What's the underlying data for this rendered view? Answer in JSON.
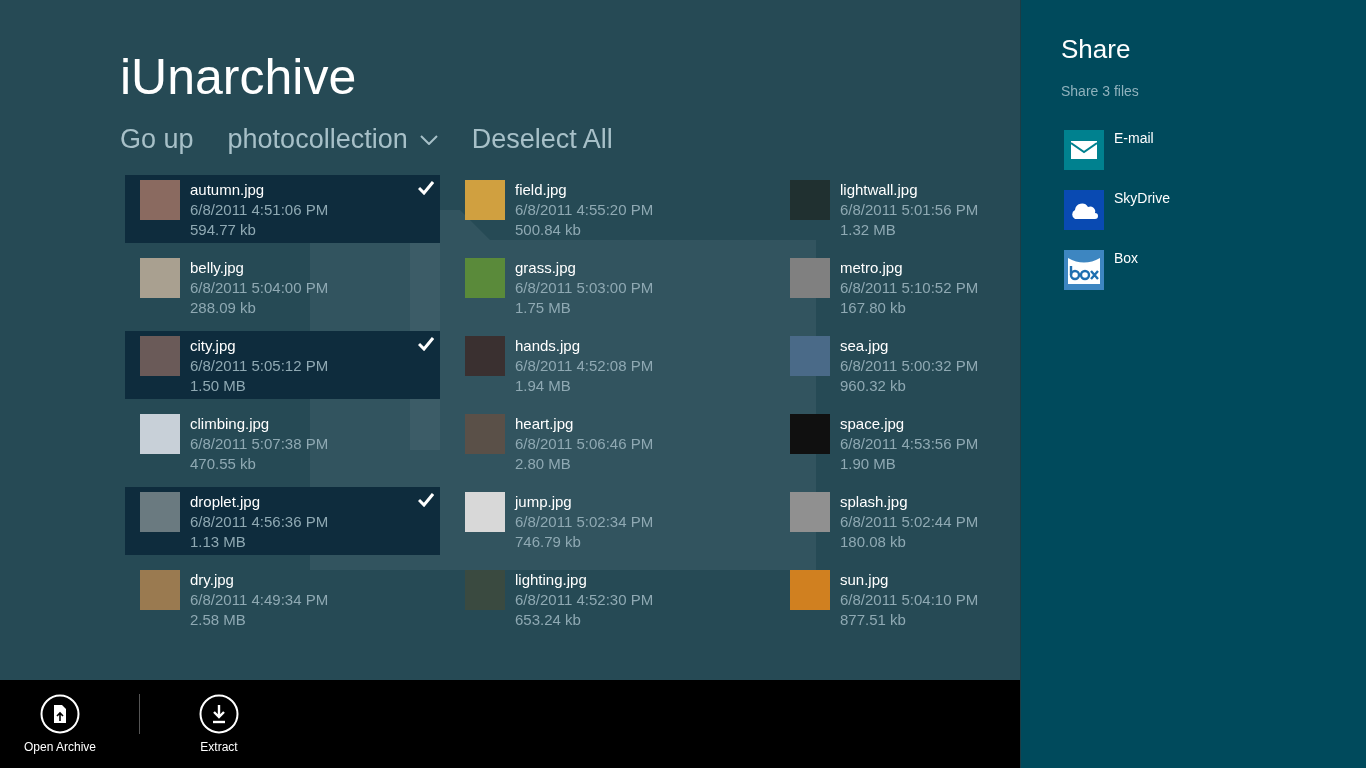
{
  "app": {
    "title": "iUnarchive"
  },
  "nav": [
    {
      "kind": "link",
      "label": "Go up"
    },
    {
      "kind": "dropdown",
      "label": "photocollection"
    },
    {
      "kind": "link",
      "label": "Deselect All"
    }
  ],
  "files": [
    {
      "name": "autumn.jpg",
      "date": "6/8/2011 4:51:06 PM",
      "size": "594.77 kb",
      "selected": true
    },
    {
      "name": "belly.jpg",
      "date": "6/8/2011 5:04:00 PM",
      "size": "288.09 kb",
      "selected": false
    },
    {
      "name": "city.jpg",
      "date": "6/8/2011 5:05:12 PM",
      "size": "1.50 MB",
      "selected": true
    },
    {
      "name": "climbing.jpg",
      "date": "6/8/2011 5:07:38 PM",
      "size": "470.55 kb",
      "selected": false
    },
    {
      "name": "droplet.jpg",
      "date": "6/8/2011 4:56:36 PM",
      "size": "1.13 MB",
      "selected": true
    },
    {
      "name": "dry.jpg",
      "date": "6/8/2011 4:49:34 PM",
      "size": "2.58 MB",
      "selected": false
    },
    {
      "name": "field.jpg",
      "date": "6/8/2011 4:55:20 PM",
      "size": "500.84 kb",
      "selected": false
    },
    {
      "name": "grass.jpg",
      "date": "6/8/2011 5:03:00 PM",
      "size": "1.75 MB",
      "selected": false
    },
    {
      "name": "hands.jpg",
      "date": "6/8/2011 4:52:08 PM",
      "size": "1.94 MB",
      "selected": false
    },
    {
      "name": "heart.jpg",
      "date": "6/8/2011 5:06:46 PM",
      "size": "2.80 MB",
      "selected": false
    },
    {
      "name": "jump.jpg",
      "date": "6/8/2011 5:02:34 PM",
      "size": "746.79 kb",
      "selected": false
    },
    {
      "name": "lighting.jpg",
      "date": "6/8/2011 4:52:30 PM",
      "size": "653.24 kb",
      "selected": false
    },
    {
      "name": "lightwall.jpg",
      "date": "6/8/2011 5:01:56 PM",
      "size": "1.32 MB",
      "selected": false
    },
    {
      "name": "metro.jpg",
      "date": "6/8/2011 5:10:52 PM",
      "size": "167.80 kb",
      "selected": false
    },
    {
      "name": "sea.jpg",
      "date": "6/8/2011 5:00:32 PM",
      "size": "960.32 kb",
      "selected": false
    },
    {
      "name": "space.jpg",
      "date": "6/8/2011 4:53:56 PM",
      "size": "1.90 MB",
      "selected": false
    },
    {
      "name": "splash.jpg",
      "date": "6/8/2011 5:02:44 PM",
      "size": "180.08 kb",
      "selected": false
    },
    {
      "name": "sun.jpg",
      "date": "6/8/2011 5:04:10 PM",
      "size": "877.51 kb",
      "selected": false
    }
  ],
  "app_bar": [
    {
      "kind": "open",
      "label": "Open Archive"
    },
    {
      "kind": "extract",
      "label": "Extract"
    }
  ],
  "share": {
    "title": "Share",
    "subtitle": "Share 3 files",
    "targets": [
      {
        "kind": "email",
        "label": "E-mail",
        "color": "#00818f"
      },
      {
        "kind": "skydrive",
        "label": "SkyDrive",
        "color": "#094ab2"
      },
      {
        "kind": "box",
        "label": "Box",
        "color": "#3d86c1"
      }
    ]
  }
}
